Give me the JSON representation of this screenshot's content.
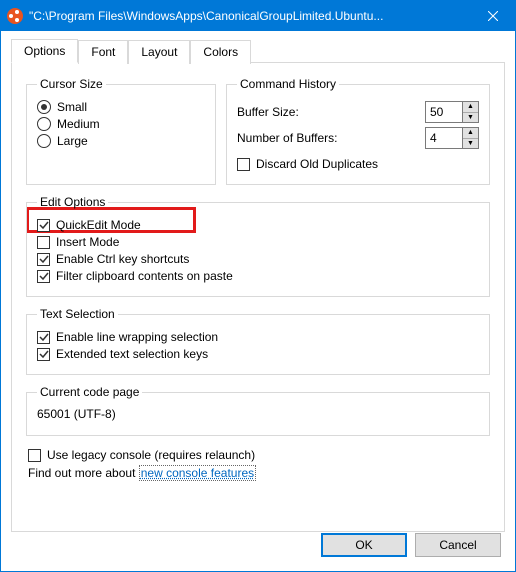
{
  "window": {
    "title": "\"C:\\Program Files\\WindowsApps\\CanonicalGroupLimited.Ubuntu..."
  },
  "tabs": {
    "options": "Options",
    "font": "Font",
    "layout": "Layout",
    "colors": "Colors"
  },
  "cursor": {
    "legend": "Cursor Size",
    "small": "Small",
    "medium": "Medium",
    "large": "Large"
  },
  "history": {
    "legend": "Command History",
    "buffer_size_label": "Buffer Size:",
    "buffer_size_value": "50",
    "num_buffers_label": "Number of Buffers:",
    "num_buffers_value": "4",
    "discard_label": "Discard Old Duplicates"
  },
  "edit": {
    "legend": "Edit Options",
    "quickedit": "QuickEdit Mode",
    "insert": "Insert Mode",
    "ctrl": "Enable Ctrl key shortcuts",
    "filter": "Filter clipboard contents on paste"
  },
  "textsel": {
    "legend": "Text Selection",
    "wrap": "Enable line wrapping selection",
    "extended": "Extended text selection keys"
  },
  "codepage": {
    "legend": "Current code page",
    "value": "65001 (UTF-8)"
  },
  "legacy": {
    "label": "Use legacy console (requires relaunch)",
    "hint_prefix": "Find out more about ",
    "hint_link": "new console features"
  },
  "buttons": {
    "ok": "OK",
    "cancel": "Cancel"
  }
}
